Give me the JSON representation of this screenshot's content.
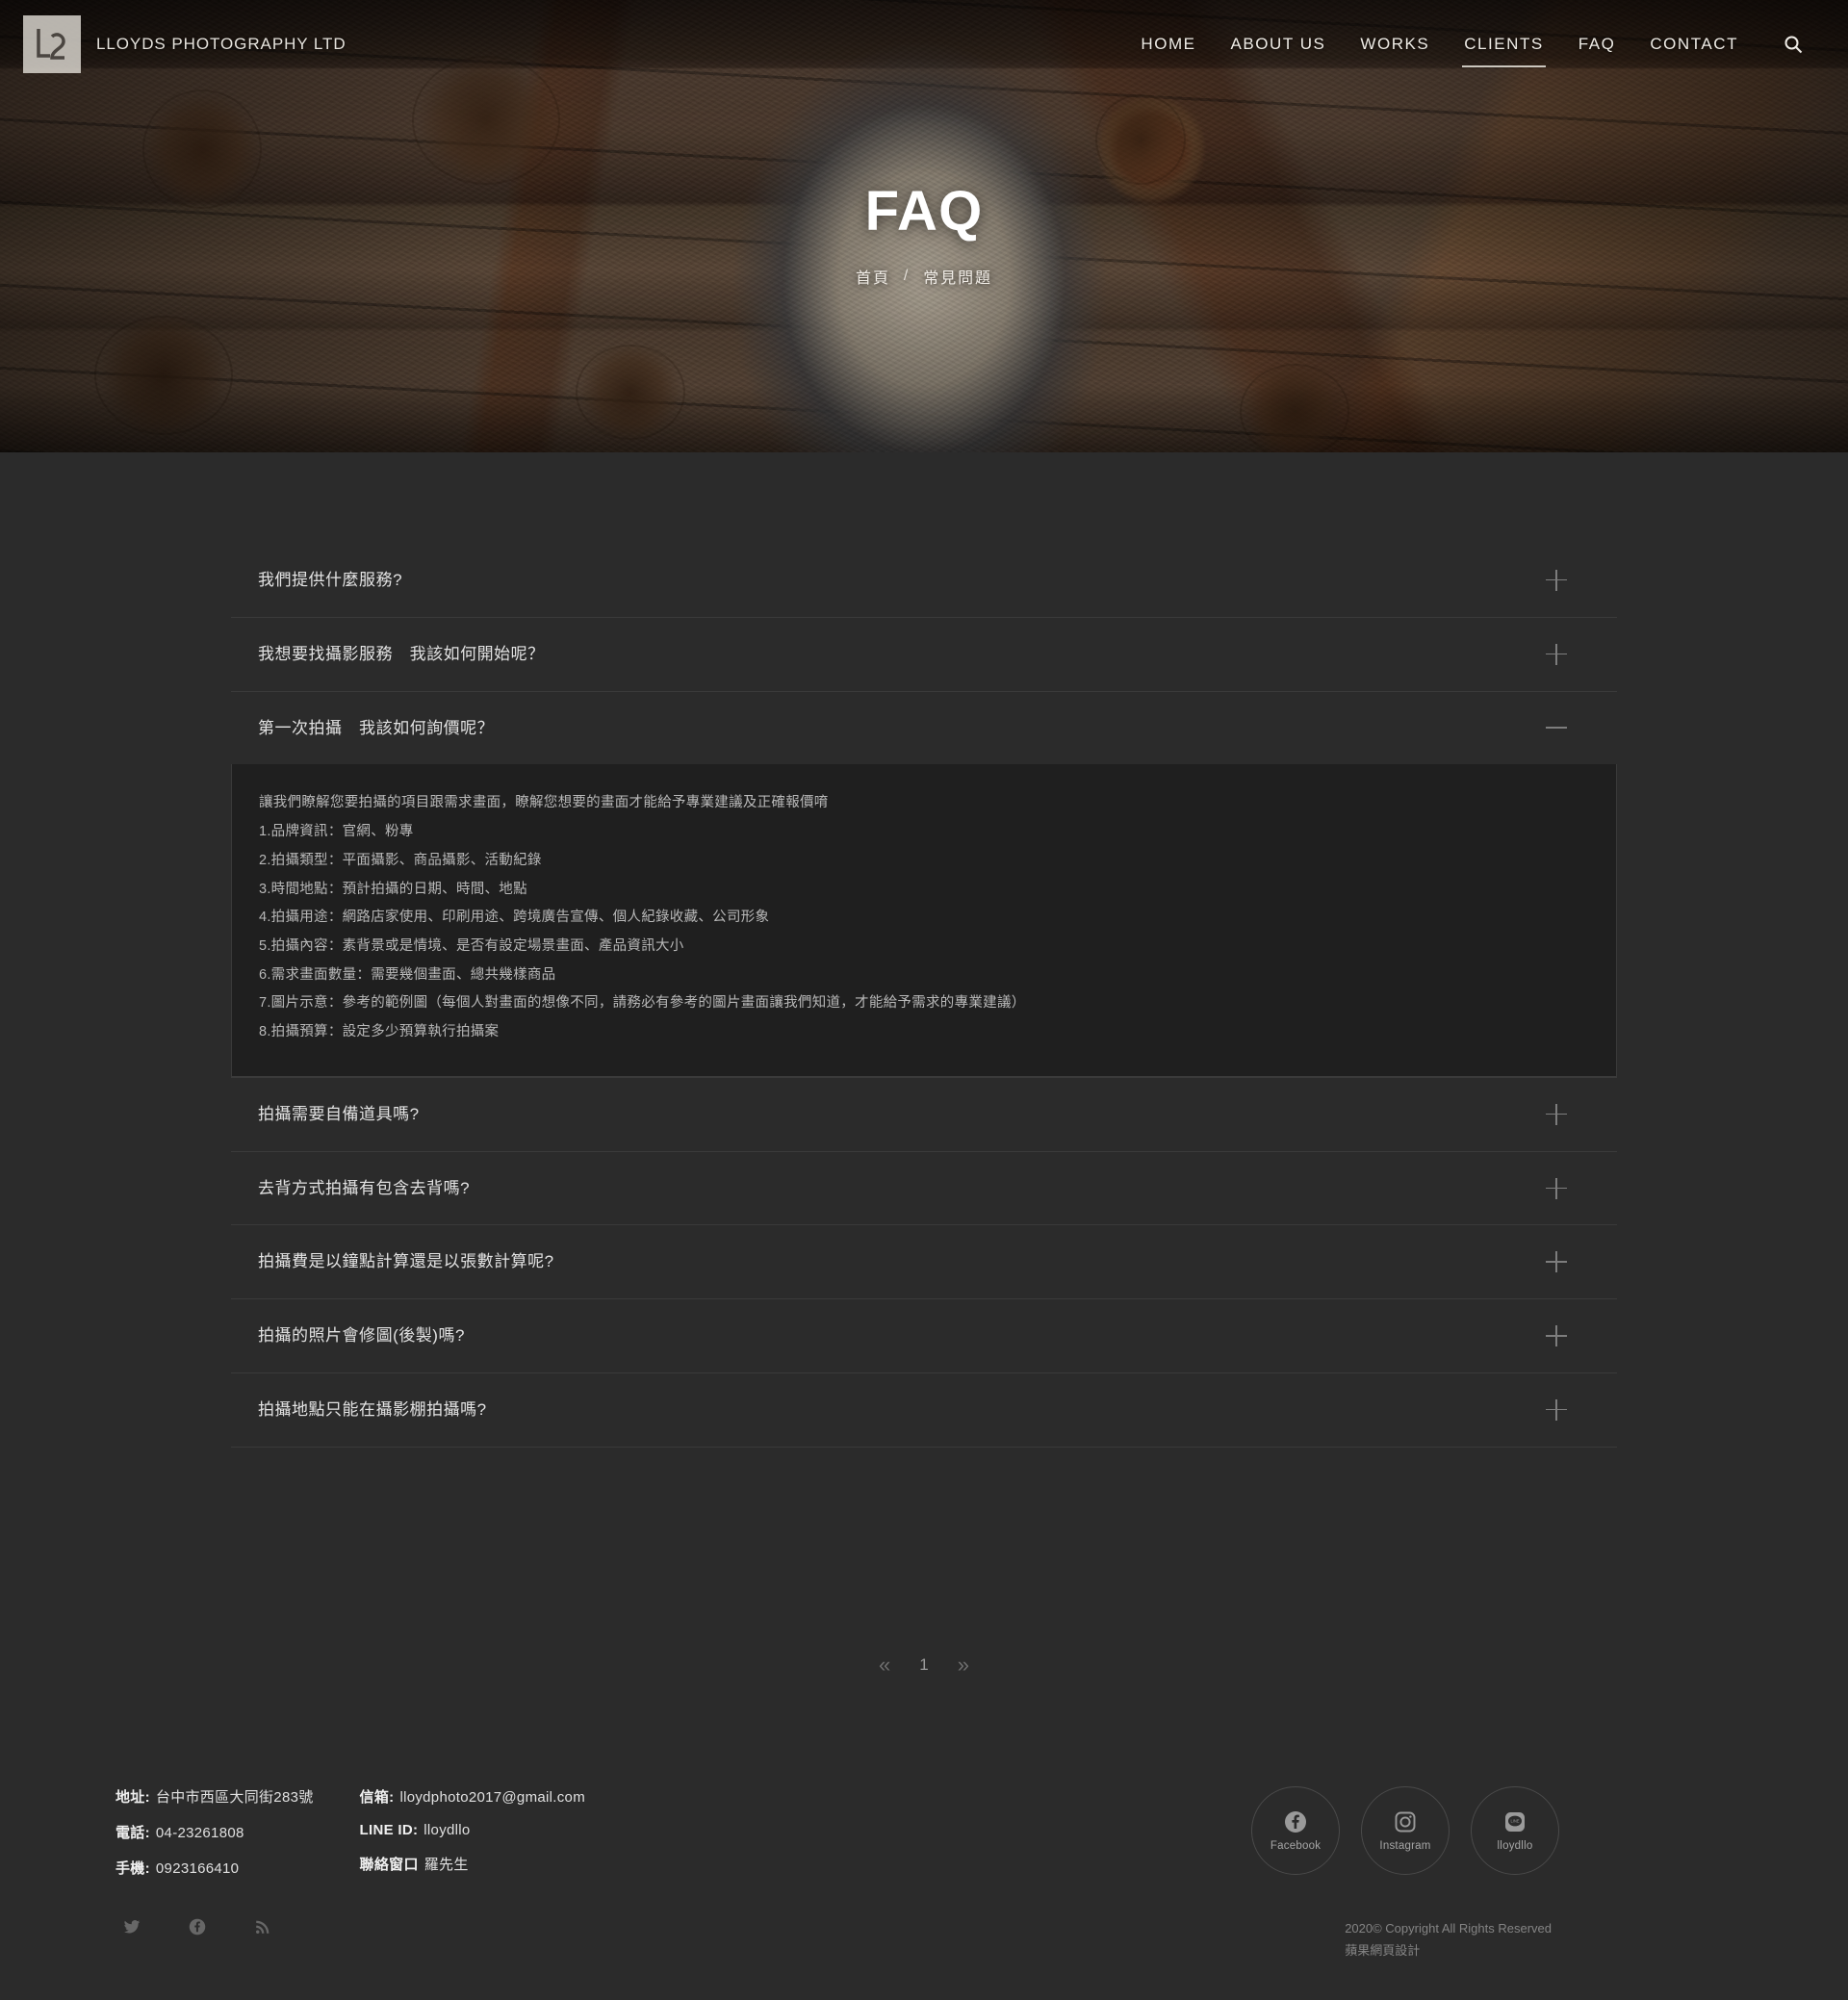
{
  "site": {
    "brand_name": "LLOYDS PHOTOGRAPHY LTD",
    "logo_icon": "lloyds-l2-monogram"
  },
  "nav": {
    "items": [
      {
        "label": "HOME",
        "active": false
      },
      {
        "label": "ABOUT US",
        "active": false
      },
      {
        "label": "WORKS",
        "active": false
      },
      {
        "label": "CLIENTS",
        "active": true
      },
      {
        "label": "FAQ",
        "active": false
      },
      {
        "label": "CONTACT",
        "active": false
      }
    ],
    "search_icon": "search-icon"
  },
  "hero": {
    "title": "FAQ",
    "breadcrumb_home": "首頁",
    "breadcrumb_sep": "/",
    "breadcrumb_current": "常見問題"
  },
  "faq": {
    "items": [
      {
        "question": "我們提供什麼服務?",
        "open": false,
        "answer_lines": []
      },
      {
        "question": "我想要找攝影服務　我該如何開始呢？",
        "open": false,
        "answer_lines": []
      },
      {
        "question": "第一次拍攝　我該如何詢價呢？",
        "open": true,
        "answer_lines": [
          "讓我們瞭解您要拍攝的項目跟需求畫面，瞭解您想要的畫面才能給予專業建議及正確報價唷",
          "1.品牌資訊：官網、粉專",
          "2.拍攝類型：平面攝影、商品攝影、活動紀錄",
          "3.時間地點：預計拍攝的日期、時間、地點",
          "4.拍攝用途：網路店家使用、印刷用途、跨境廣告宣傳、個人紀錄收藏、公司形象",
          "5.拍攝內容：素背景或是情境、是否有設定場景畫面、產品資訊大小",
          "6.需求畫面數量：需要幾個畫面、總共幾樣商品",
          "7.圖片示意：參考的範例圖（每個人對畫面的想像不同，請務必有參考的圖片畫面讓我們知道，才能給予需求的專業建議）",
          "8.拍攝預算：設定多少預算執行拍攝案"
        ]
      },
      {
        "question": "拍攝需要自備道具嗎?",
        "open": false,
        "answer_lines": []
      },
      {
        "question": "去背方式拍攝有包含去背嗎?",
        "open": false,
        "answer_lines": []
      },
      {
        "question": "拍攝費是以鐘點計算還是以張數計算呢?",
        "open": false,
        "answer_lines": []
      },
      {
        "question": "拍攝的照片會修圖(後製)嗎?",
        "open": false,
        "answer_lines": []
      },
      {
        "question": "拍攝地點只能在攝影棚拍攝嗎?",
        "open": false,
        "answer_lines": []
      }
    ]
  },
  "pagination": {
    "prev_icon": "«",
    "next_icon": "»",
    "current_page": "1"
  },
  "footer": {
    "contact_left": [
      {
        "label": "地址:",
        "value": "台中市西區大同街283號"
      },
      {
        "label": "電話:",
        "value": "04-23261808"
      },
      {
        "label": "手機:",
        "value": "0923166410"
      }
    ],
    "contact_right": [
      {
        "label": "信箱:",
        "value": "lloydphoto2017@gmail.com"
      },
      {
        "label": "LINE ID:",
        "value": "lloydllo"
      },
      {
        "label": "聯絡窗口",
        "value": "羅先生"
      }
    ],
    "socials": [
      {
        "caption": "Facebook",
        "icon": "facebook-icon"
      },
      {
        "caption": "Instagram",
        "icon": "instagram-icon"
      },
      {
        "caption": "lloydllo",
        "icon": "line-icon"
      }
    ],
    "mini_socials": [
      {
        "icon": "twitter-icon"
      },
      {
        "icon": "facebook-icon"
      },
      {
        "icon": "rss-icon"
      }
    ],
    "copyright": "2020© Copyright All Rights Reserved",
    "designer": "蘋果網頁設計"
  },
  "colors": {
    "page_bg": "#2b2b2b",
    "panel_bg": "#1f1f1f",
    "divider": "#3a3a3a",
    "text_primary": "#e3e3e3",
    "text_muted": "#b8b8b8",
    "text_dim": "#848484"
  }
}
